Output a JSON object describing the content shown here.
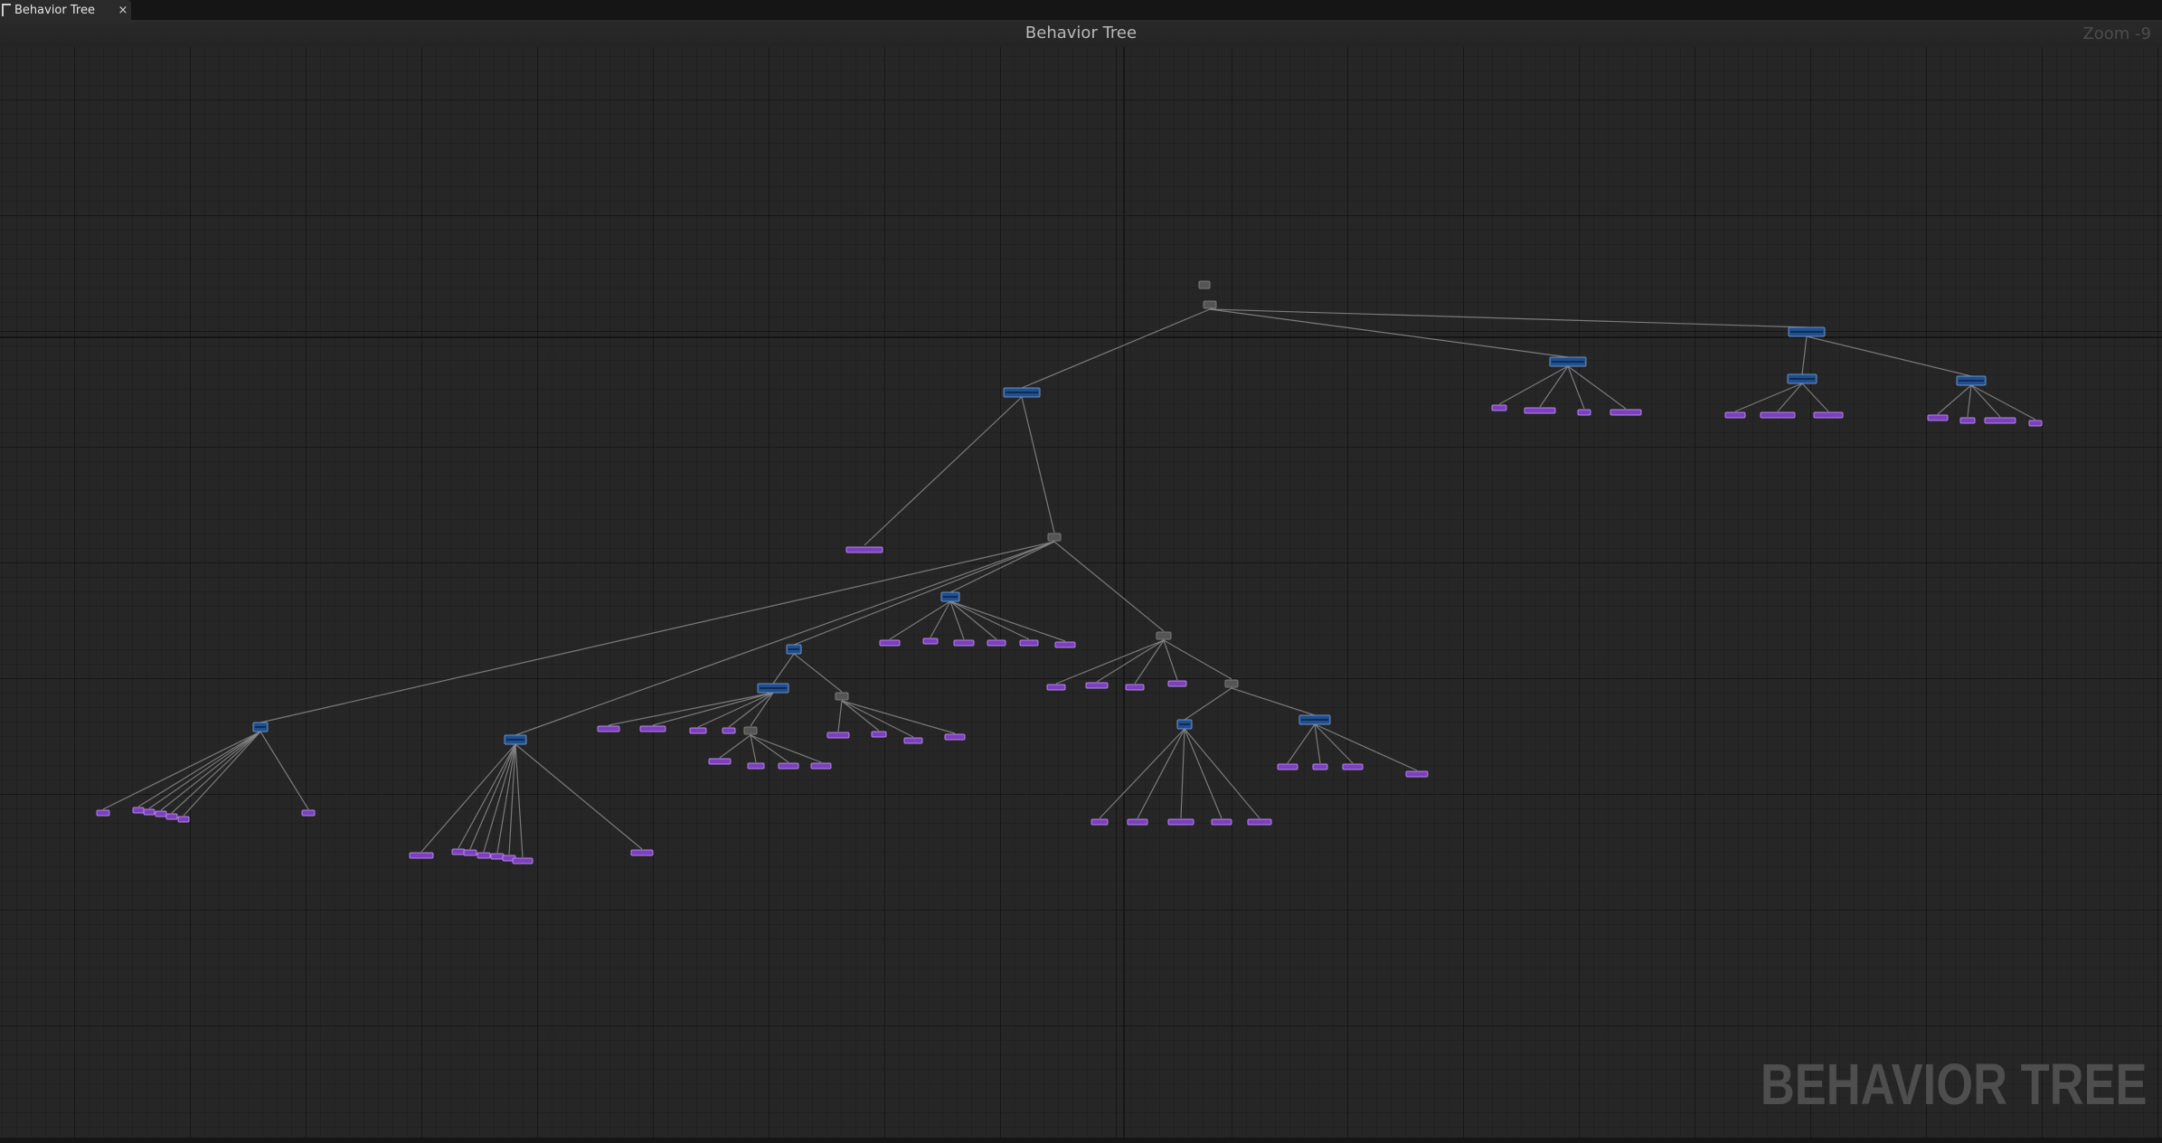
{
  "tab": {
    "label": "Behavior Tree",
    "close_glyph": "×",
    "icon": "behavior-tree-icon"
  },
  "header": {
    "title": "Behavior Tree",
    "zoom": "Zoom -9"
  },
  "watermark": "BEHAVIOR TREE",
  "colors": {
    "background": "#262626",
    "composite_node": "#1f4f8f",
    "task_node": "#7d3fbf",
    "root_node": "#555555",
    "wire": "#8a8a8a"
  }
}
